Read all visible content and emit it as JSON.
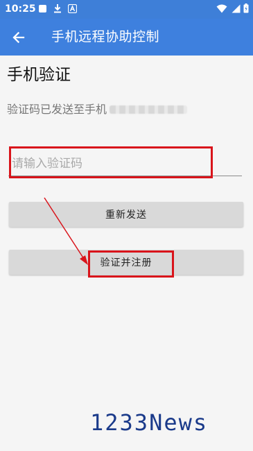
{
  "status_bar": {
    "time": "10:25",
    "left_icons": [
      "square-icon",
      "download-icon",
      "app-a-icon"
    ],
    "right_icons": [
      "wifi-icon",
      "signal-icon",
      "battery-icon"
    ]
  },
  "app_bar": {
    "back_icon": "arrow-left-icon",
    "title": "手机远程协助控制"
  },
  "page": {
    "heading": "手机验证",
    "sent_text": "验证码已发送至手机"
  },
  "code_input": {
    "placeholder": "请输入验证码",
    "value": ""
  },
  "buttons": {
    "resend": "重新发送",
    "verify_register": "验证并注册"
  },
  "watermark": "1233News",
  "colors": {
    "app_bar": "#3e80de",
    "status_bar": "#3e7fd8",
    "annotation": "#d9141b",
    "button_bg": "#d9d9d9",
    "watermark": "#1a3a8a"
  }
}
